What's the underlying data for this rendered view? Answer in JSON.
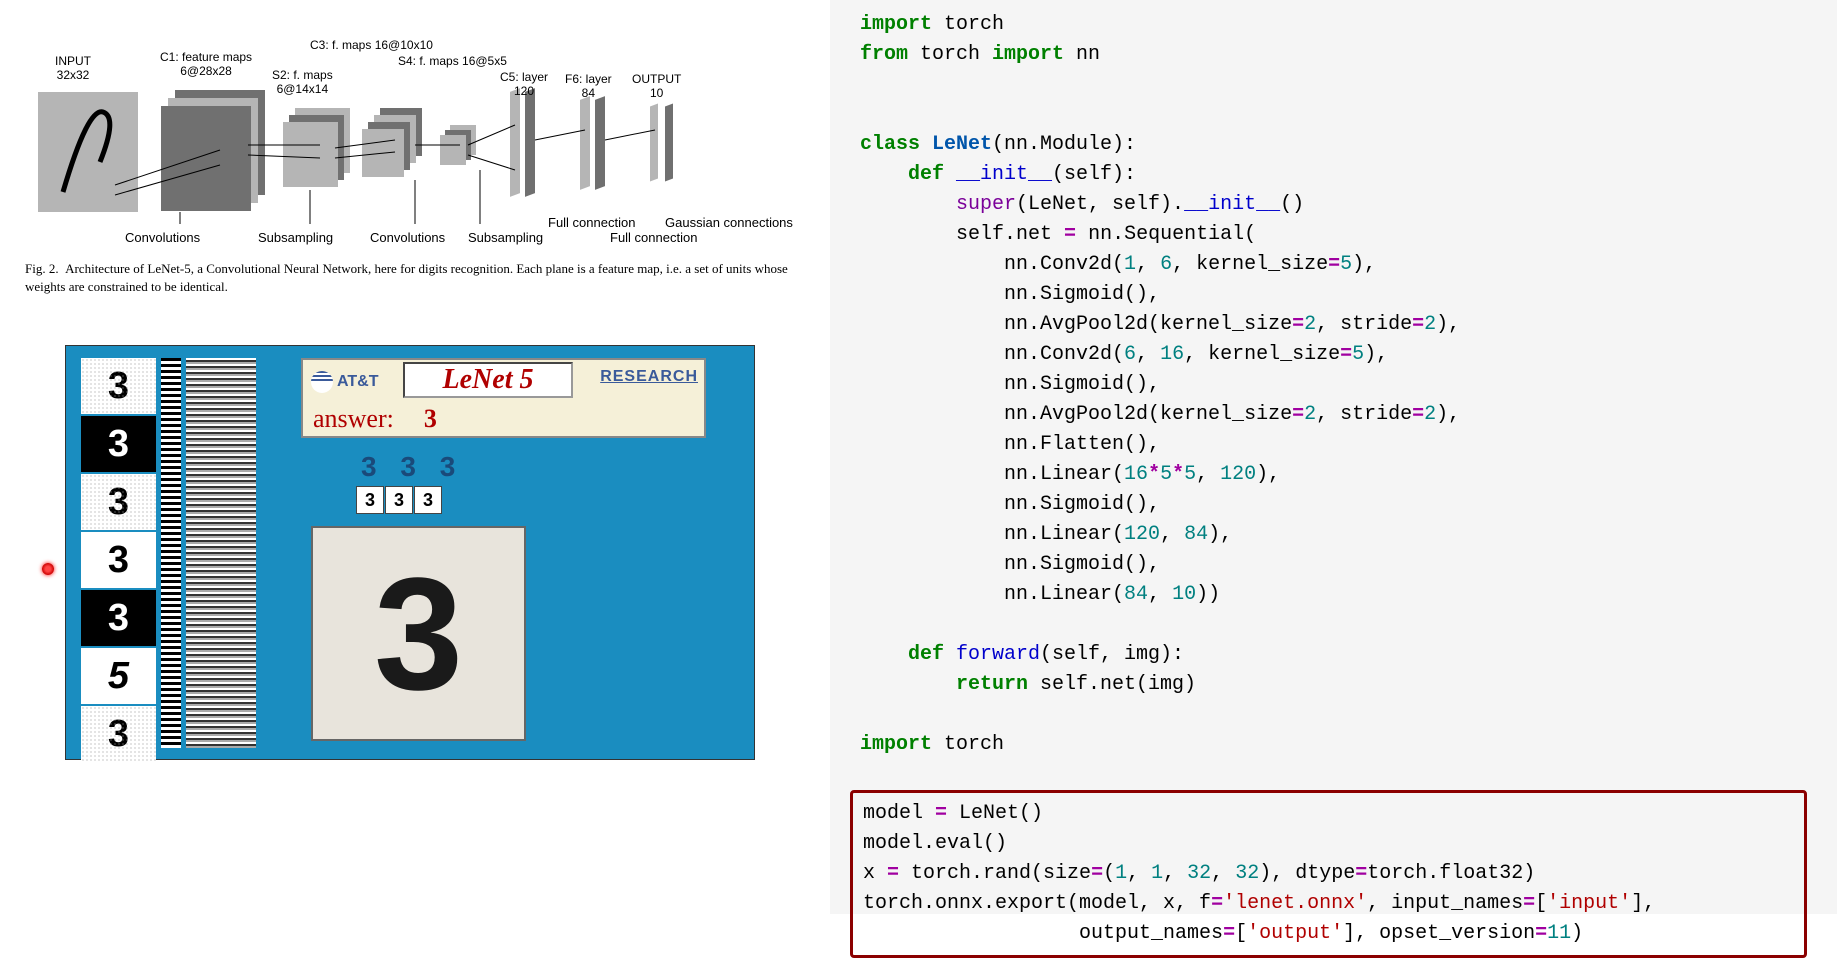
{
  "arch": {
    "input_label": "INPUT",
    "input_dim": "32x32",
    "c1_label": "C1: feature maps",
    "c1_dim": "6@28x28",
    "s2_label": "S2: f. maps",
    "s2_dim": "6@14x14",
    "c3_label": "C3: f. maps 16@10x10",
    "s4_label": "S4: f. maps 16@5x5",
    "c5_label": "C5: layer",
    "c5_dim": "120",
    "f6_label": "F6: layer",
    "f6_dim": "84",
    "out_label": "OUTPUT",
    "out_dim": "10",
    "conv1": "Convolutions",
    "sub1": "Subsampling",
    "conv2": "Convolutions",
    "sub2": "Subsampling",
    "fc1": "Full connection",
    "fc2": "Full connection",
    "gauss": "Gaussian connections"
  },
  "caption": {
    "prefix": "Fig. 2.",
    "text": "Architecture of LeNet-5, a Convolutional Neural Network, here for digits recognition. Each plane is a feature map, i.e. a set of units whose weights are constrained to be identical."
  },
  "demo": {
    "brand": "AT&T",
    "title": "LeNet 5",
    "research": "RESEARCH",
    "answer_label": "answer:",
    "answer_value": "3",
    "tri": "3 3 3",
    "tiny1": "3",
    "tiny2": "3",
    "tiny3": "3",
    "big": "3",
    "d1": "3",
    "d2": "3",
    "d3": "3",
    "d4": "3",
    "d5": "3",
    "d6": "5",
    "d7": "3"
  },
  "code": {
    "l01a": "import",
    "l01b": " torch",
    "l02a": "from",
    "l02b": " torch ",
    "l02c": "import",
    "l02d": " nn",
    "l04a": "class ",
    "l04b": "LeNet",
    "l04c": "(nn.Module):",
    "l05a": "    def ",
    "l05b": "__init__",
    "l05c": "(self):",
    "l06a": "        super",
    "l06b": "(LeNet, self).",
    "l06c": "__init__",
    "l06d": "()",
    "l07a": "        self.net ",
    "l07b": "=",
    "l07c": " nn.Sequential(",
    "l08a": "            nn.Conv2d(",
    "l08b": "1",
    "l08c": ", ",
    "l08d": "6",
    "l08e": ", kernel_size",
    "l08f": "=",
    "l08g": "5",
    "l08h": "),",
    "l09a": "            nn.Sigmoid(),",
    "l10a": "            nn.AvgPool2d(kernel_size",
    "l10b": "=",
    "l10c": "2",
    "l10d": ", stride",
    "l10e": "=",
    "l10f": "2",
    "l10g": "),",
    "l11a": "            nn.Conv2d(",
    "l11b": "6",
    "l11c": ", ",
    "l11d": "16",
    "l11e": ", kernel_size",
    "l11f": "=",
    "l11g": "5",
    "l11h": "),",
    "l12a": "            nn.Sigmoid(),",
    "l13a": "            nn.AvgPool2d(kernel_size",
    "l13b": "=",
    "l13c": "2",
    "l13d": ", stride",
    "l13e": "=",
    "l13f": "2",
    "l13g": "),",
    "l14a": "            nn.Flatten(),",
    "l15a": "            nn.Linear(",
    "l15b": "16",
    "l15c": "*",
    "l15d": "5",
    "l15e": "*",
    "l15f": "5",
    "l15g": ", ",
    "l15h": "120",
    "l15i": "),",
    "l16a": "            nn.Sigmoid(),",
    "l17a": "            nn.Linear(",
    "l17b": "120",
    "l17c": ", ",
    "l17d": "84",
    "l17e": "),",
    "l18a": "            nn.Sigmoid(),",
    "l19a": "            nn.Linear(",
    "l19b": "84",
    "l19c": ", ",
    "l19d": "10",
    "l19e": "))",
    "l21a": "    def ",
    "l21b": "forward",
    "l21c": "(self, img):",
    "l22a": "        return ",
    "l22b": "self.net(img)",
    "l24a": "import",
    "l24b": " torch",
    "l26a": "model ",
    "l26b": "=",
    "l26c": " LeNet()",
    "l27a": "model.eval()",
    "l28a": "x ",
    "l28b": "=",
    "l28c": " torch.rand(size",
    "l28d": "=",
    "l28e": "(",
    "l28f": "1",
    "l28g": ", ",
    "l28h": "1",
    "l28i": ", ",
    "l28j": "32",
    "l28k": ", ",
    "l28l": "32",
    "l28m": "), dtype",
    "l28n": "=",
    "l28o": "torch.float32)",
    "l29a": "torch.onnx.export(model, x, f",
    "l29b": "=",
    "l29c": "'lenet.onnx'",
    "l29d": ", input_names",
    "l29e": "=",
    "l29f": "[",
    "l29g": "'input'",
    "l29h": "],",
    "l30a": "                  output_names",
    "l30b": "=",
    "l30c": "[",
    "l30d": "'output'",
    "l30e": "], opset_version",
    "l30f": "=",
    "l30g": "11",
    "l30h": ")"
  }
}
